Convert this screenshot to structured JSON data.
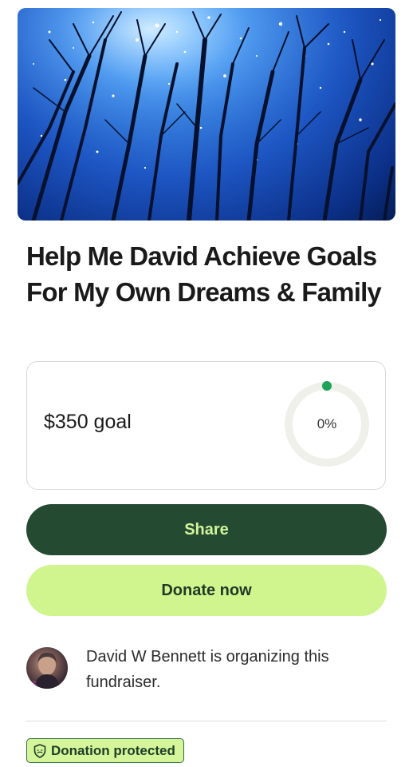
{
  "campaign": {
    "title": "Help Me David Achieve Goals For My Own Dreams & Family",
    "goal_label": "$350 goal",
    "progress_label": "0%",
    "progress_fraction": 0.0
  },
  "actions": {
    "share_label": "Share",
    "donate_label": "Donate now"
  },
  "organizer": {
    "text": "David W Bennett is organizing this fundraiser."
  },
  "badge": {
    "label": "Donation protected",
    "icon": "shield-icon"
  },
  "colors": {
    "share_bg": "#254a32",
    "share_text": "#d3f59a",
    "donate_bg": "#d0f58f",
    "progress_dot": "#1fa35a",
    "ring_track": "#f0f0ea"
  }
}
